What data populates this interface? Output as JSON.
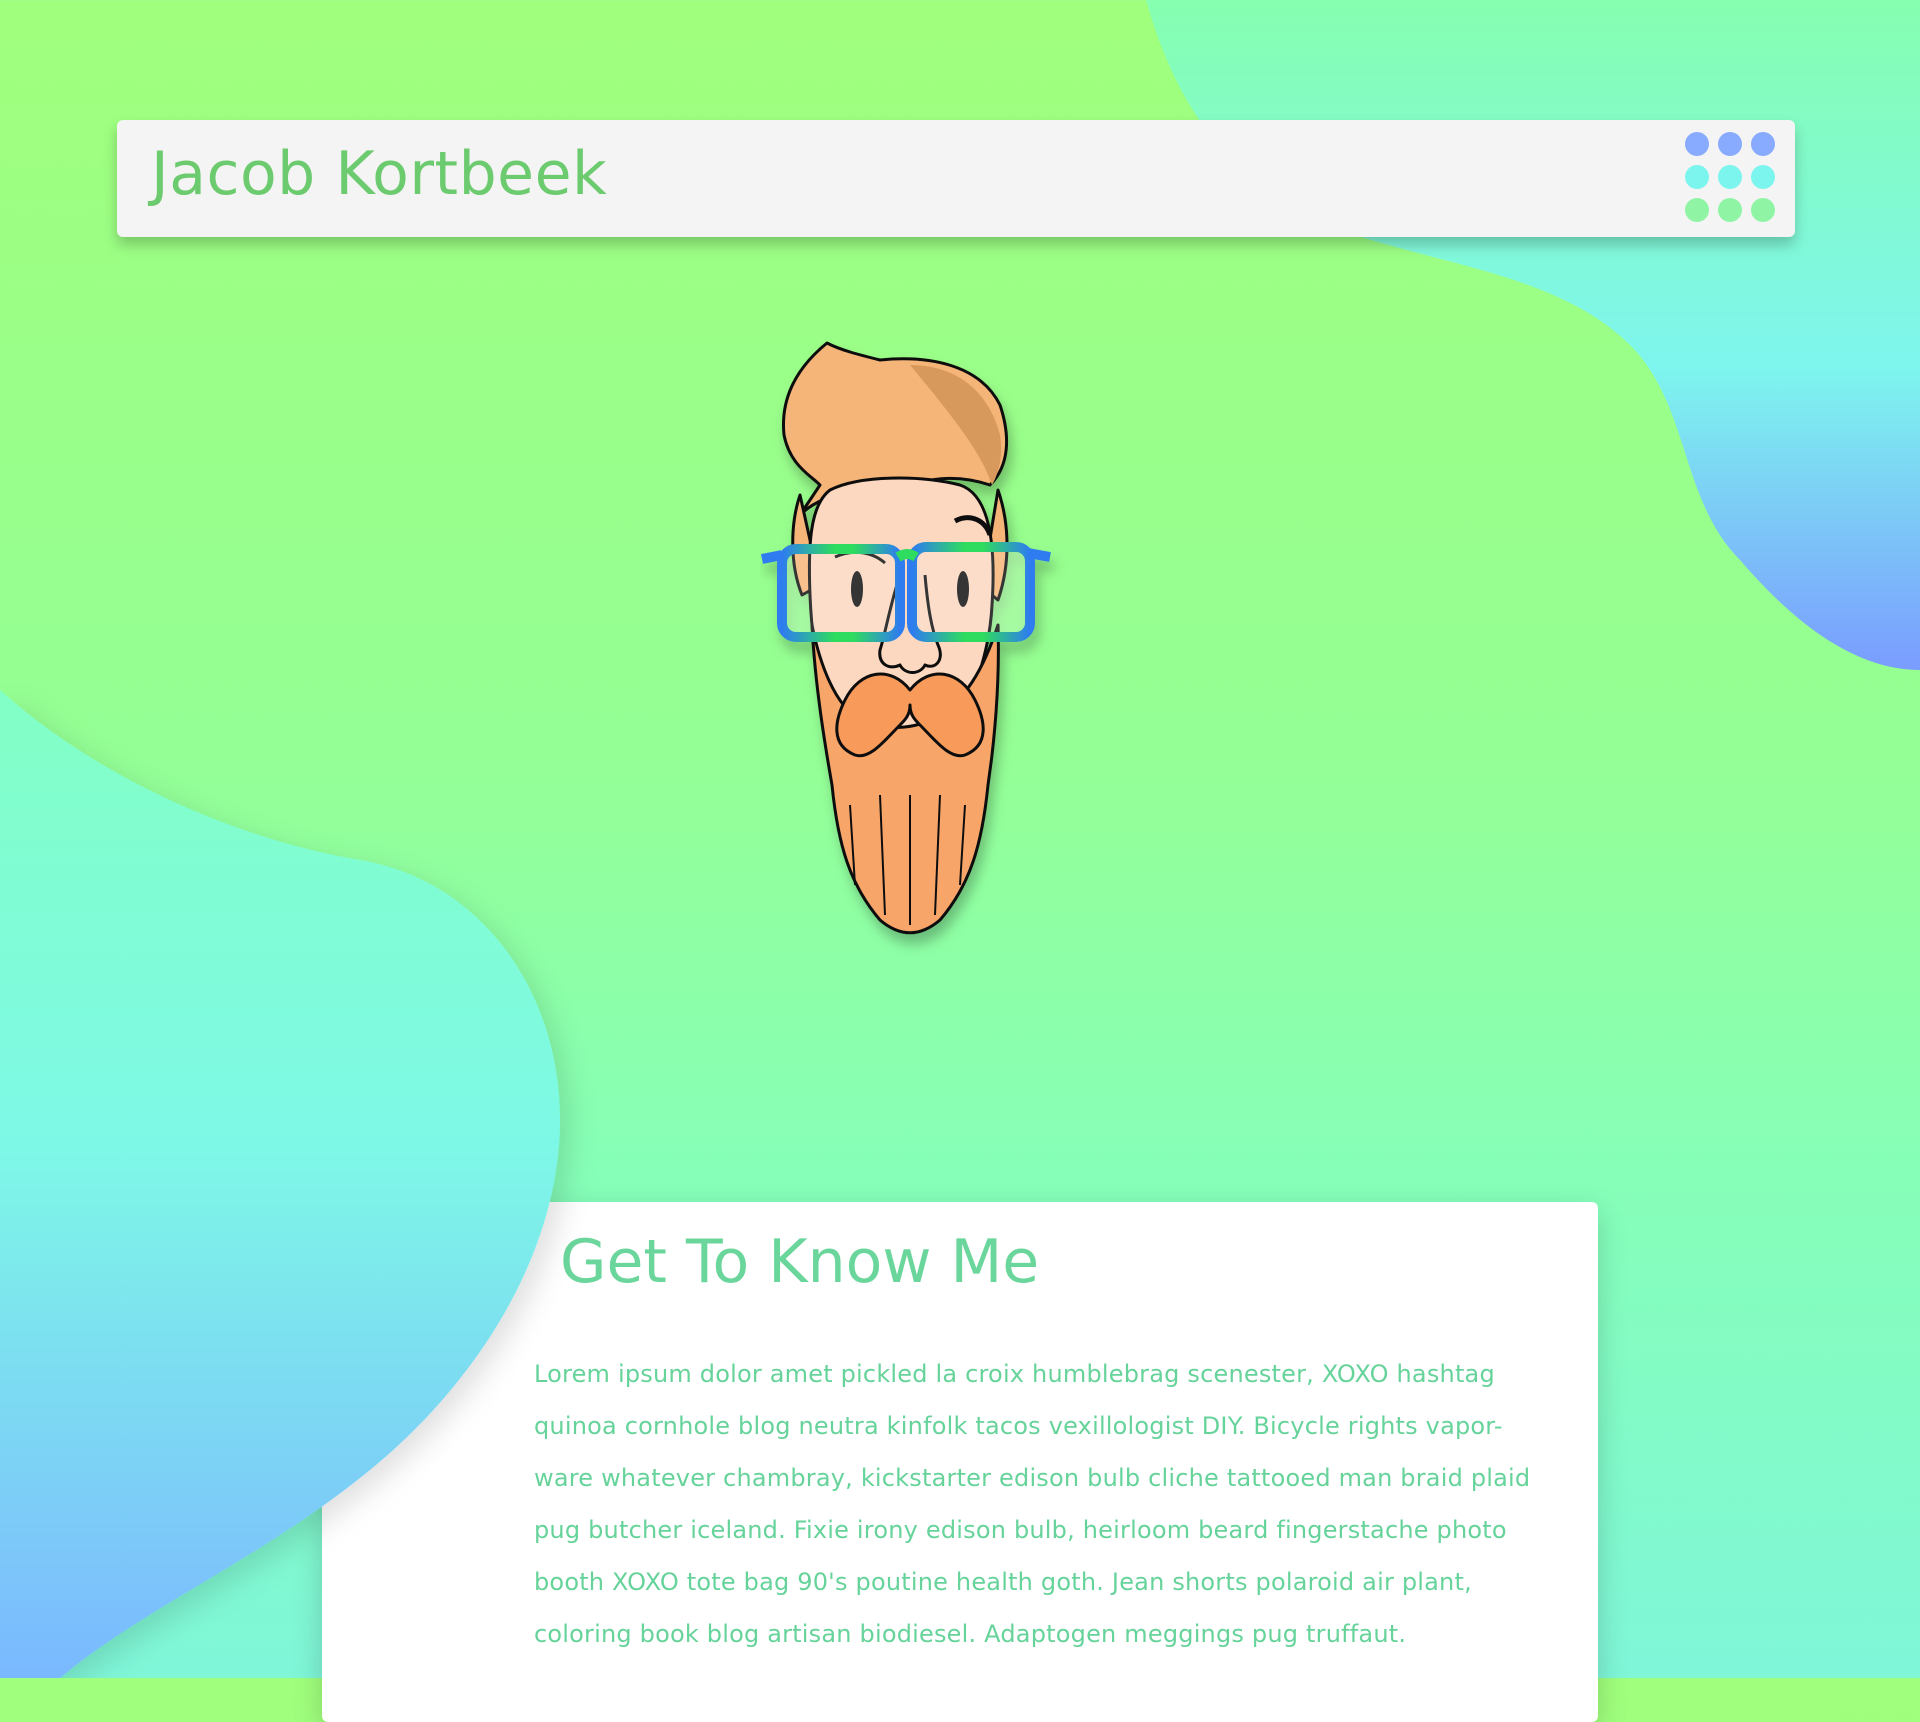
{
  "header": {
    "title": "Jacob Kortbeek",
    "menu_icon": "grid-menu-icon",
    "menu_dot_colors": [
      "#88aaff",
      "#88aaff",
      "#88aaff",
      "#7cf5ee",
      "#7cf5ee",
      "#7cf5ee",
      "#8ff5a5",
      "#8ff5a5",
      "#8ff5a5"
    ]
  },
  "avatar": {
    "icon": "bearded-man-illustration"
  },
  "about": {
    "title": "Get To Know Me",
    "body_lines": [
      "Lorem ipsum dolor amet pickled la croix humblebrag scenester, XOXO hashtag",
      "quinoa cornhole blog neutra kinfolk tacos vexillologist DIY. Bicycle rights vapor-",
      "ware whatever chambray, kickstarter edison bulb cliche tattooed man braid plaid",
      "pug butcher iceland. Fixie irony edison bulb, heirloom beard fingerstache photo",
      "booth XOXO tote bag 90's poutine health goth. Jean shorts polaroid air plant,",
      "coloring book blog artisan biodiesel. Adaptogen meggings pug truffaut."
    ]
  },
  "colors": {
    "header_text": "#6ccb6f",
    "about_text": "#66d39a",
    "bg_top": "#a0ff7c",
    "bg_bottom": "#7ff6d8",
    "blob_cyan": "#7ef9e6",
    "blob_blue": "#7aa6ff"
  }
}
